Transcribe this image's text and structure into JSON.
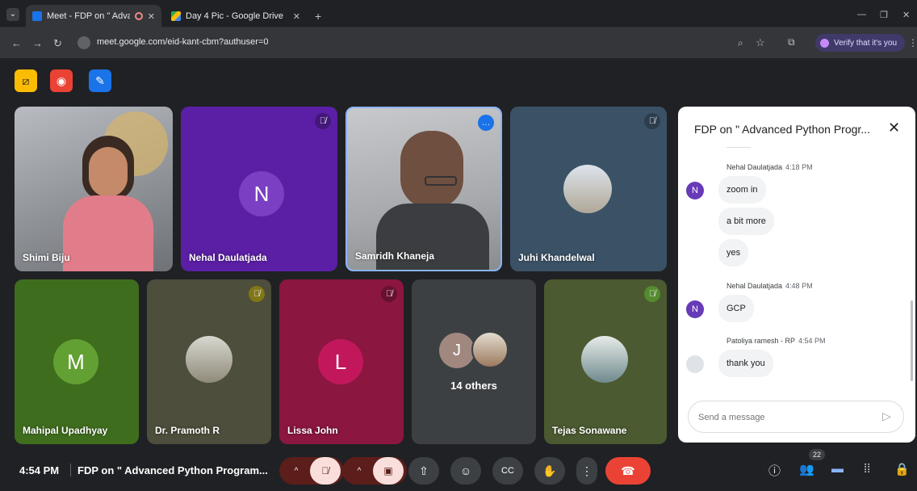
{
  "browser": {
    "tabs": [
      {
        "title": "Meet - FDP on \" Advanced",
        "active": true
      },
      {
        "title": "Day 4 Pic - Google Drive",
        "active": false
      }
    ],
    "new_tab": "+",
    "url": "meet.google.com/eid-kant-cbm?authuser=0",
    "verify_label": "Verify that it's you"
  },
  "meeting": {
    "time": "4:54 PM",
    "title": "FDP on \" Advanced Python Program..."
  },
  "participants": [
    {
      "name": "Shimi Biju",
      "initial": ""
    },
    {
      "name": "Nehal Daulatjada",
      "initial": "N"
    },
    {
      "name": "Samridh Khaneja",
      "initial": ""
    },
    {
      "name": "Juhi Khandelwal",
      "initial": ""
    },
    {
      "name": "Mahipal Upadhyay",
      "initial": "M"
    },
    {
      "name": "Dr. Pramoth R",
      "initial": ""
    },
    {
      "name": "Lissa John",
      "initial": "L"
    },
    {
      "name": "Tejas Sonawane",
      "initial": ""
    }
  ],
  "others": {
    "label": "14 others",
    "initial": "J"
  },
  "people_count": "22",
  "chat": {
    "title": "FDP on \" Advanced Python Progr...",
    "messages": [
      {
        "sender": "Nehal Daulatjada",
        "time": "4:18 PM",
        "initial": "N",
        "lines": [
          "zoom in",
          "a bit more",
          "yes"
        ]
      },
      {
        "sender": "Nehal Daulatjada",
        "time": "4:48 PM",
        "initial": "N",
        "lines": [
          "GCP"
        ]
      },
      {
        "sender": "Patoliya ramesh - RP",
        "time": "4:54 PM",
        "initial": "",
        "lines": [
          "thank you"
        ]
      }
    ],
    "input_placeholder": "Send a message"
  },
  "colors": {
    "meet_bg": "#202124",
    "end_call": "#ea4335",
    "accent_blue": "#8ab4f8",
    "muted_red": "#f9dedc"
  }
}
